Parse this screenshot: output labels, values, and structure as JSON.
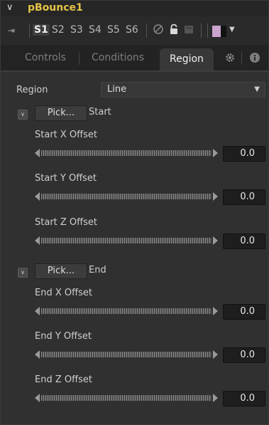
{
  "header": {
    "tool_name": "pBounce1"
  },
  "toolbar": {
    "scenes": [
      "S1",
      "S2",
      "S3",
      "S4",
      "S5",
      "S6"
    ],
    "active_scene": "S1",
    "color_swatch": "#c9a4cc"
  },
  "tabs": [
    {
      "label": "Controls"
    },
    {
      "label": "Conditions"
    },
    {
      "label": "Region"
    }
  ],
  "active_tab": "Region",
  "region": {
    "label": "Region",
    "value": "Line"
  },
  "start": {
    "pick_label": "Pick...",
    "label": "Start",
    "sliders": [
      {
        "label": "Start X Offset",
        "value": "0.0"
      },
      {
        "label": "Start Y Offset",
        "value": "0.0"
      },
      {
        "label": "Start Z Offset",
        "value": "0.0"
      }
    ]
  },
  "end": {
    "pick_label": "Pick...",
    "label": "End",
    "sliders": [
      {
        "label": "End X Offset",
        "value": "0.0"
      },
      {
        "label": "End Y Offset",
        "value": "0.0"
      },
      {
        "label": "End Z Offset",
        "value": "0.0"
      }
    ]
  }
}
